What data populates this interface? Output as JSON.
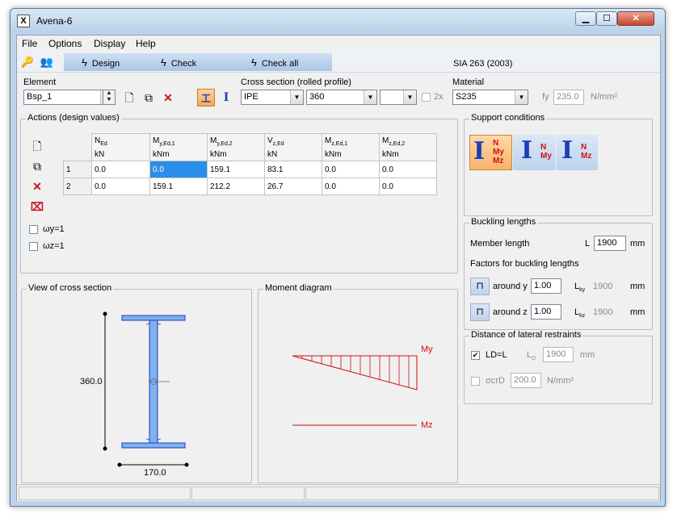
{
  "window": {
    "title": "Avena-6"
  },
  "menu": [
    "File",
    "Options",
    "Display",
    "Help"
  ],
  "toolbar": {
    "design": "Design",
    "check": "Check",
    "check_all": "Check all",
    "norm": "SIA 263 (2003)"
  },
  "element": {
    "label": "Element",
    "value": "Bsp_1"
  },
  "cross_section": {
    "label": "Cross section (rolled profile)",
    "type": "IPE",
    "size": "360",
    "option": "",
    "double_label": "2x"
  },
  "material": {
    "label": "Material",
    "value": "S235",
    "fy_label": "fy",
    "fy_value": "235.0",
    "fy_unit": "N/mm²"
  },
  "actions": {
    "title": "Actions (design values)",
    "columns": [
      {
        "sym": "N",
        "sub": "Ed",
        "unit": "kN"
      },
      {
        "sym": "M",
        "sub": "y,Ed,1",
        "unit": "kNm"
      },
      {
        "sym": "M",
        "sub": "y,Ed,2",
        "unit": "kNm"
      },
      {
        "sym": "V",
        "sub": "z,Ed",
        "unit": "kN"
      },
      {
        "sym": "M",
        "sub": "z,Ed,1",
        "unit": "kNm"
      },
      {
        "sym": "M",
        "sub": "z,Ed,2",
        "unit": "kNm"
      }
    ],
    "rows": [
      {
        "id": "1",
        "values": [
          "0.0",
          "0.0",
          "159.1",
          "83.1",
          "0.0",
          "0.0"
        ]
      },
      {
        "id": "2",
        "values": [
          "0.0",
          "159.1",
          "212.2",
          "26.7",
          "0.0",
          "0.0"
        ]
      }
    ],
    "omega_y": "ωy=1",
    "omega_z": "ωz=1"
  },
  "support": {
    "title": "Support conditions",
    "opt1": [
      "N",
      "My",
      "Mz"
    ],
    "opt2": [
      "N",
      "My"
    ],
    "opt3": [
      "N",
      "Mz"
    ]
  },
  "buckling": {
    "title": "Buckling lengths",
    "member_length_label": "Member length",
    "L_label": "L",
    "L_value": "1900",
    "unit": "mm",
    "factors_label": "Factors for buckling lengths",
    "around_y_label": "around y",
    "around_y_value": "1.00",
    "Lky_label": "L",
    "Lky_sub": "ky",
    "Lky_value": "1900",
    "around_z_label": "around z",
    "around_z_value": "1.00",
    "Lkz_label": "L",
    "Lkz_sub": "kz",
    "Lkz_value": "1900"
  },
  "lateral": {
    "title": "Distance of lateral restraints",
    "ld_label": "LD=L",
    "ld_checked": true,
    "LD_label": "L",
    "LD_sub": "D",
    "LD_value": "1900",
    "LD_unit": "mm",
    "sigma_label": "σcrD",
    "sigma_value": "200.0",
    "sigma_unit": "N/mm²"
  },
  "view": {
    "title": "View of cross section",
    "height_label": "360.0",
    "width_label": "170.0"
  },
  "moment": {
    "title": "Moment diagram",
    "my_label": "My",
    "mz_label": "Mz"
  }
}
